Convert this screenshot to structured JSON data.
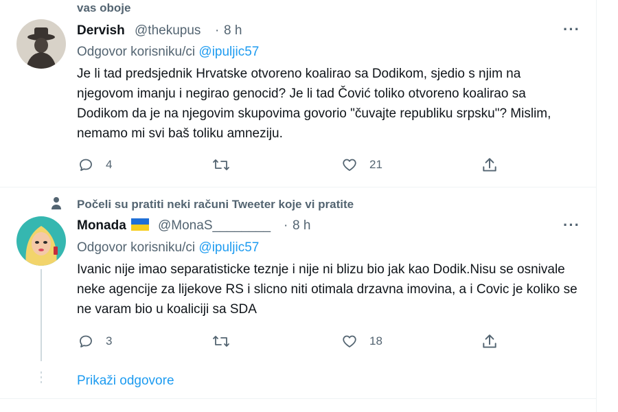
{
  "header_fragment": "vas oboje",
  "tweets": [
    {
      "name": "Dervish",
      "handle": "@thekupus",
      "dot": "·",
      "time": "8 h",
      "reply_prefix": "Odgovor korisniku/ci",
      "reply_to": "@ipuljic57",
      "text": "Je li tad predsjednik Hrvatske otvoreno koalirao sa Dodikom, sjedio s njim na njegovom imanju i negirao genocid? Je li tad Čović toliko otvoreno koalirao sa Dodikom da je na njegovim skupovima govorio \"čuvajte republiku srpsku\"? Mislim, nemamo mi svi baš toliku amneziju.",
      "replies": "4",
      "retweets": "",
      "likes": "21"
    },
    {
      "social_context": "Počeli su pratiti neki računi Tweeter koje vi pratite",
      "name": "Monada",
      "handle": "@MonaS________",
      "dot": "·",
      "time": "8 h",
      "reply_prefix": "Odgovor korisniku/ci",
      "reply_to": "@ipuljic57",
      "text": "Ivanic nije imao separatisticke teznje i nije ni blizu bio jak kao Dodik.Nisu se osnivale neke agencije za lijekove RS i slicno niti otimala drzavna imovina, a i Covic je koliko se ne varam bio u koaliciji sa SDA",
      "replies": "3",
      "retweets": "",
      "likes": "18"
    }
  ],
  "show_replies": "Prikaži odgovore",
  "colors": {
    "accent": "#1d9bf0",
    "secondary_text": "#536471",
    "primary_text": "#0f1419",
    "divider": "#eff3f4"
  },
  "icons": [
    "more-icon",
    "reply-icon",
    "retweet-icon",
    "like-icon",
    "share-icon",
    "person-icon",
    "ukraine-flag-icon"
  ]
}
